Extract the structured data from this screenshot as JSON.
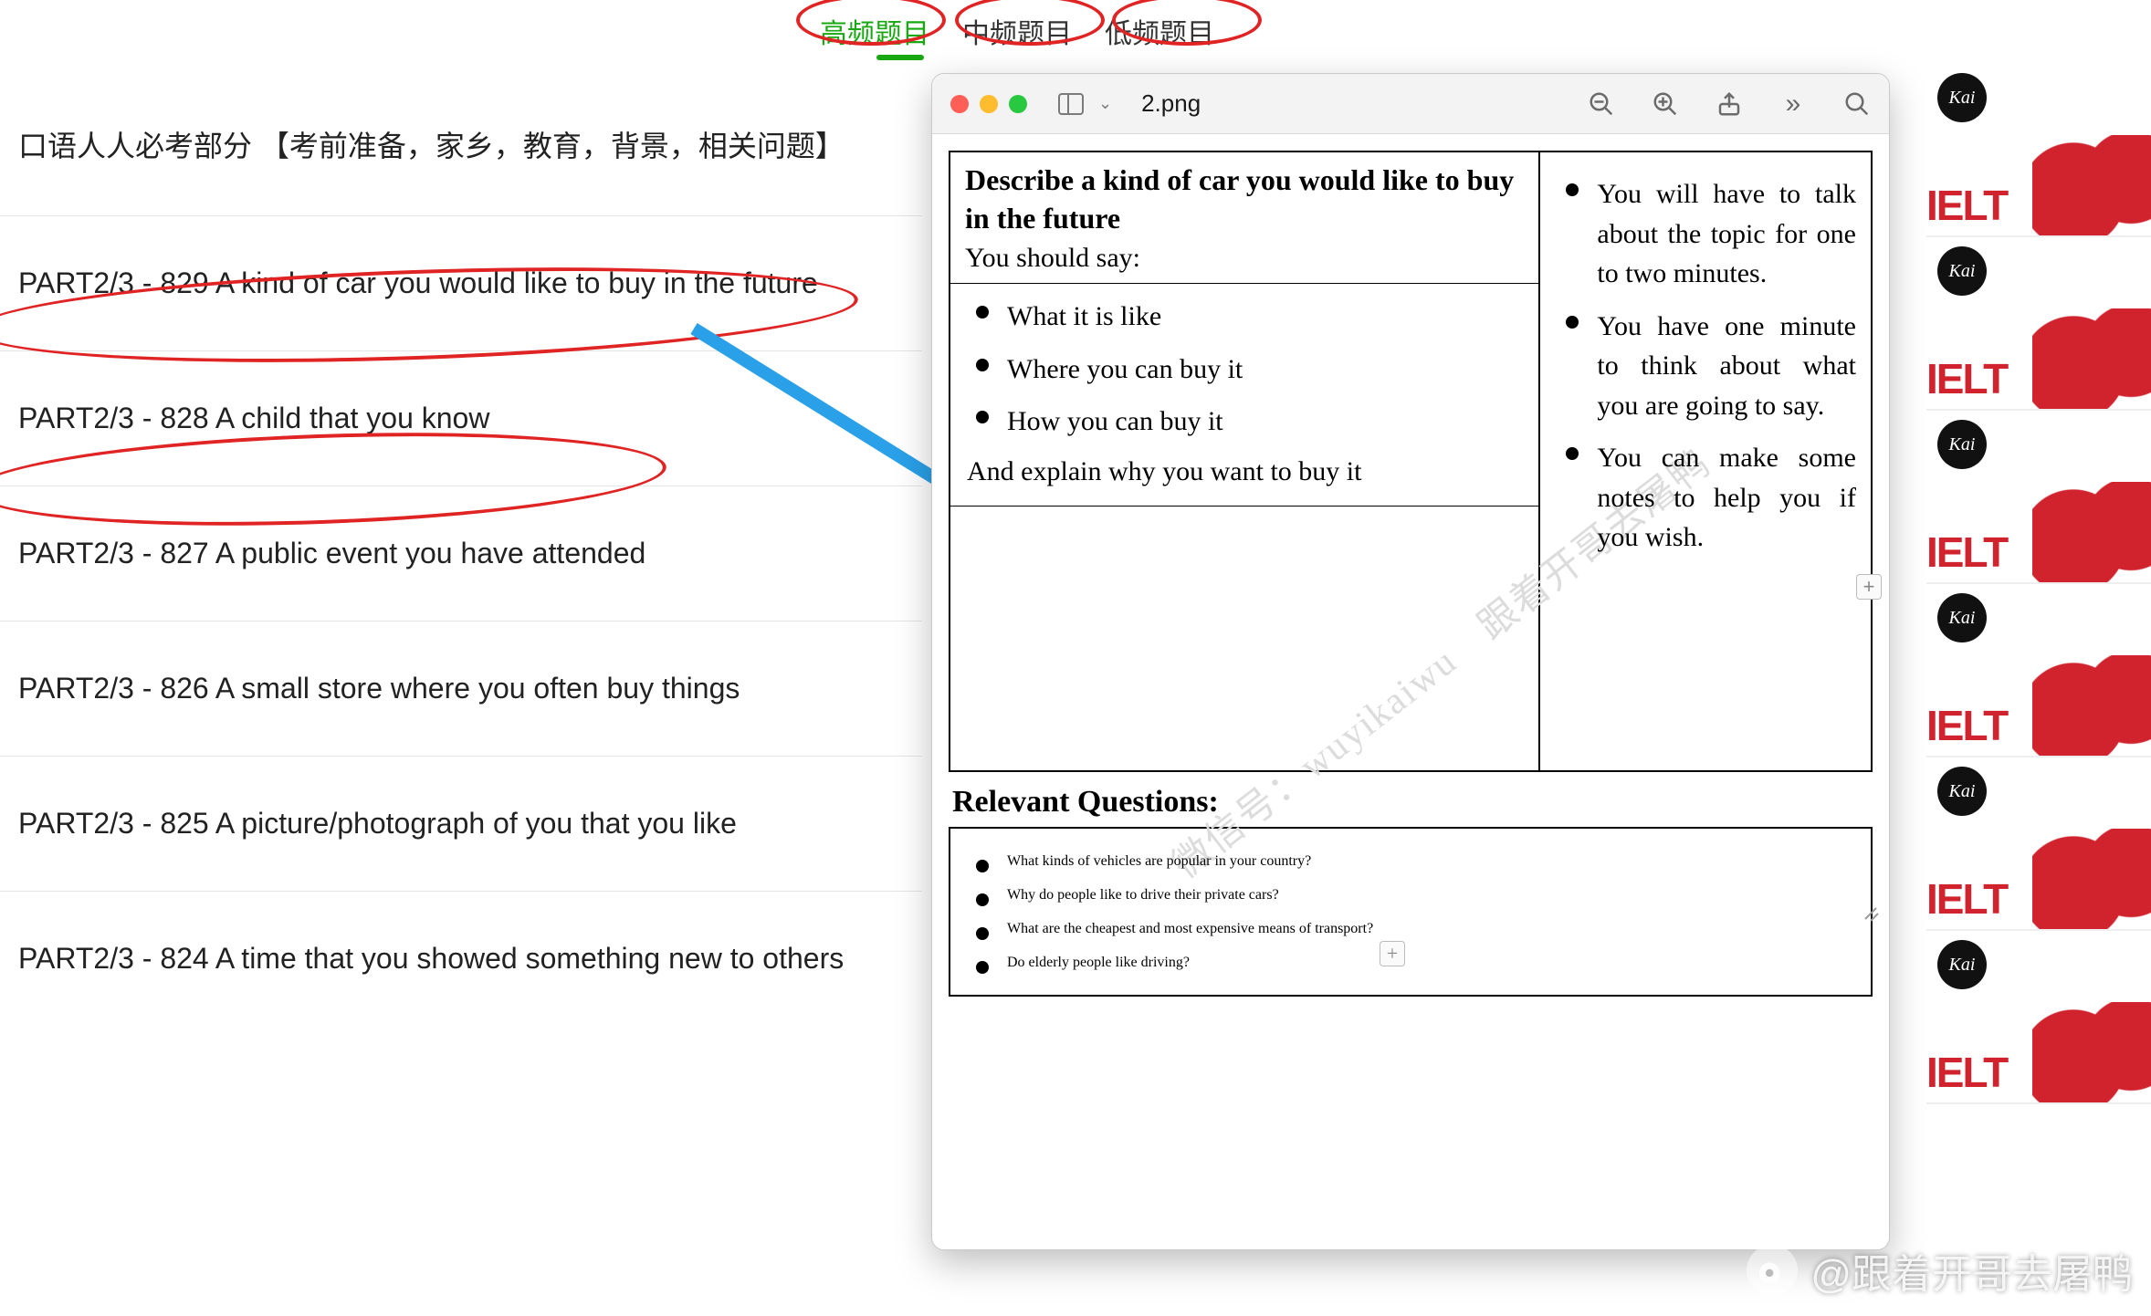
{
  "tabs": {
    "high": "高频题目",
    "mid": "中频题目",
    "low": "低频题目",
    "active": "high"
  },
  "list": {
    "header": "口语人人必考部分 【考前准备，家乡，教育，背景，相关问题】",
    "items": [
      "PART2/3 - 829 A kind of car you would like to buy in the future",
      "PART2/3 - 828 A child that you know",
      "PART2/3 - 827 A public event you have attended",
      "PART2/3 - 826 A small store where you often buy things",
      "PART2/3 - 825 A picture/photograph of you that you like",
      "PART2/3 - 824 A time that you showed something new to others"
    ]
  },
  "preview": {
    "filename": "2.png",
    "topic_title": "Describe a kind of car you would like to buy in the future",
    "you_should_say": "You should say:",
    "points": [
      "What it is like",
      "Where you can buy it",
      "How you can buy it"
    ],
    "explain": "And explain why you want to buy it",
    "right_bullets": [
      "You will have to talk about the topic for one to two minutes.",
      "You have one minute to think about what you are going to say.",
      "You can make some notes to help you if you wish."
    ],
    "rq_title": "Relevant Questions:",
    "rq": [
      "What kinds of vehicles are popular in your country?",
      "Why do people like to drive their private cars?",
      "What are the cheapest and most expensive means of transport?",
      "Do elderly people like driving?"
    ],
    "watermark": "微信号：wuyikaiwu　跟着开哥去屠鸭"
  },
  "thumbs": {
    "badge": "Kai",
    "label": "IELT",
    "count": 6
  },
  "weibo": {
    "handle": "@跟着开哥去屠鸭"
  }
}
